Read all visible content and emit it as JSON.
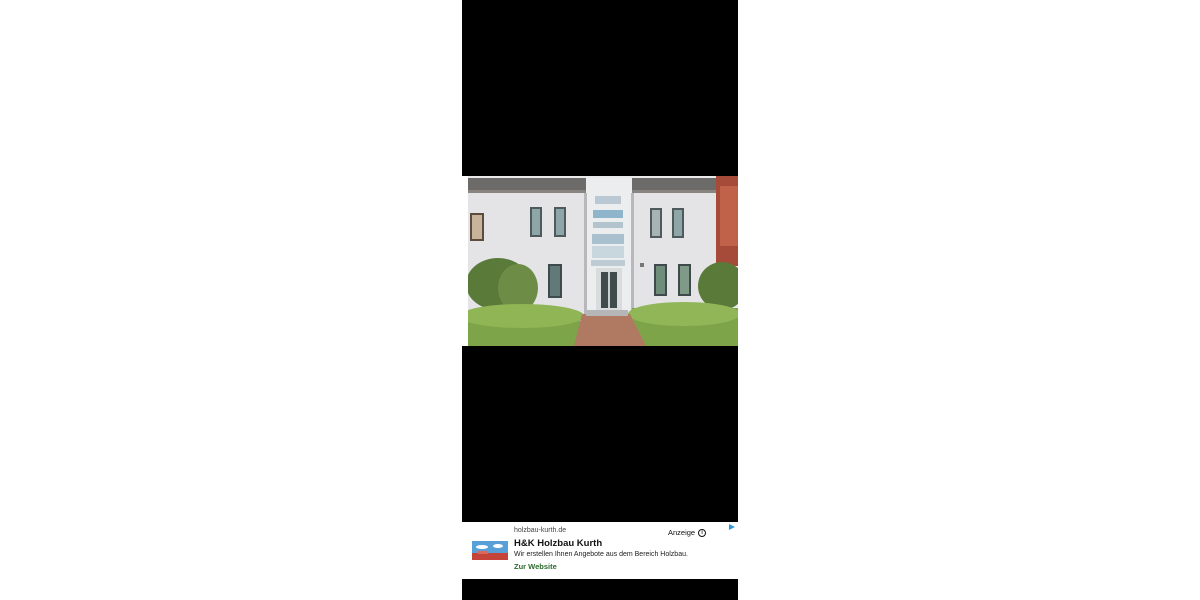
{
  "ad": {
    "domain": "holzbau-kurth.de",
    "title": "H&K Holzbau Kurth",
    "description": "Wir erstellen Ihnen Angebote aus dem Bereich Holzbau.",
    "cta": "Zur Website",
    "label": "Anzeige",
    "info_icon": "info-icon",
    "adchoices_icon": "adchoices-triangle-icon"
  },
  "photo": {
    "subject": "apartment-building-facade"
  }
}
